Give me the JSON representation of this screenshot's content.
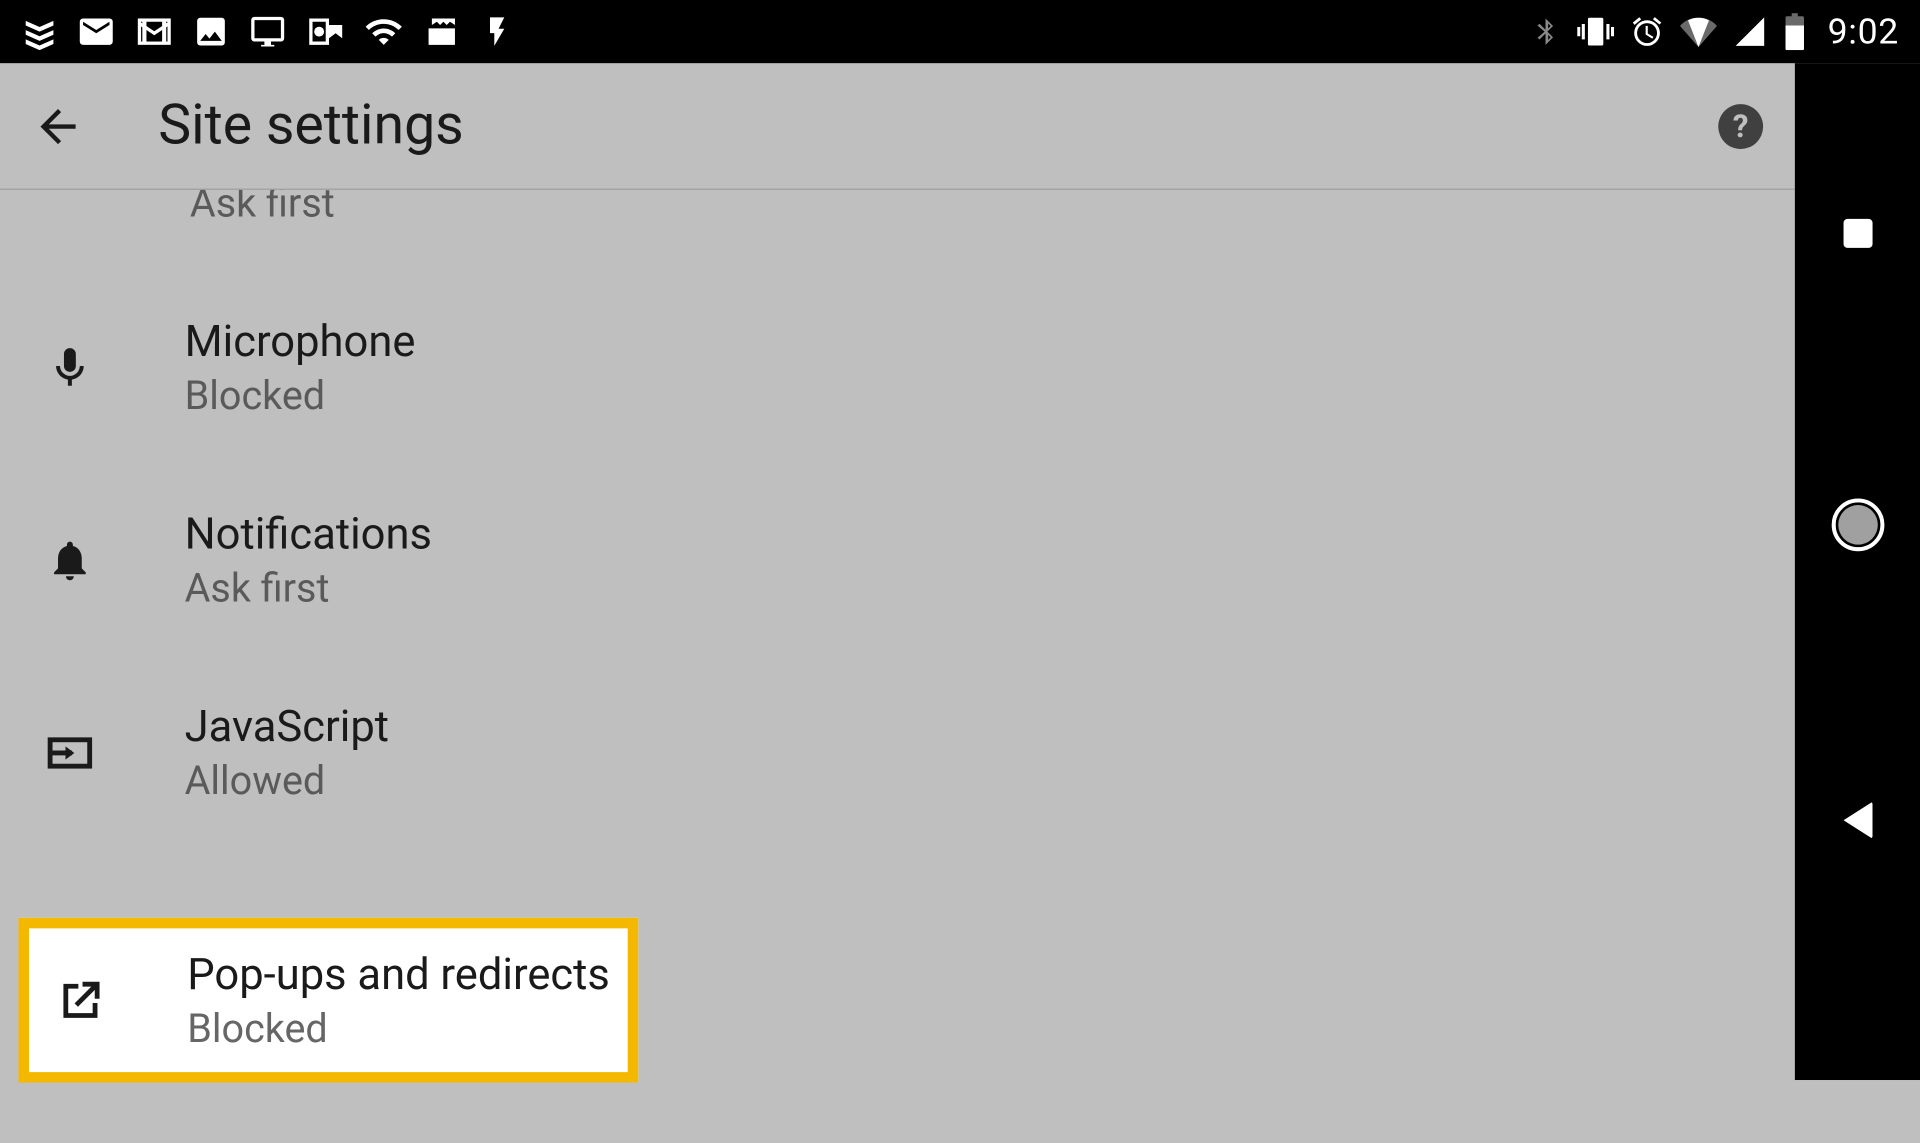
{
  "status_bar": {
    "time": "9:02"
  },
  "header": {
    "title": "Site settings"
  },
  "partial_row": {
    "subtitle": "Ask first"
  },
  "settings": [
    {
      "icon": "microphone-icon",
      "title": "Microphone",
      "subtitle": "Blocked"
    },
    {
      "icon": "bell-icon",
      "title": "Notifications",
      "subtitle": "Ask first"
    },
    {
      "icon": "javascript-icon",
      "title": "JavaScript",
      "subtitle": "Allowed"
    },
    {
      "icon": "popup-icon",
      "title": "Pop-ups and redirects",
      "subtitle": "Blocked"
    }
  ]
}
